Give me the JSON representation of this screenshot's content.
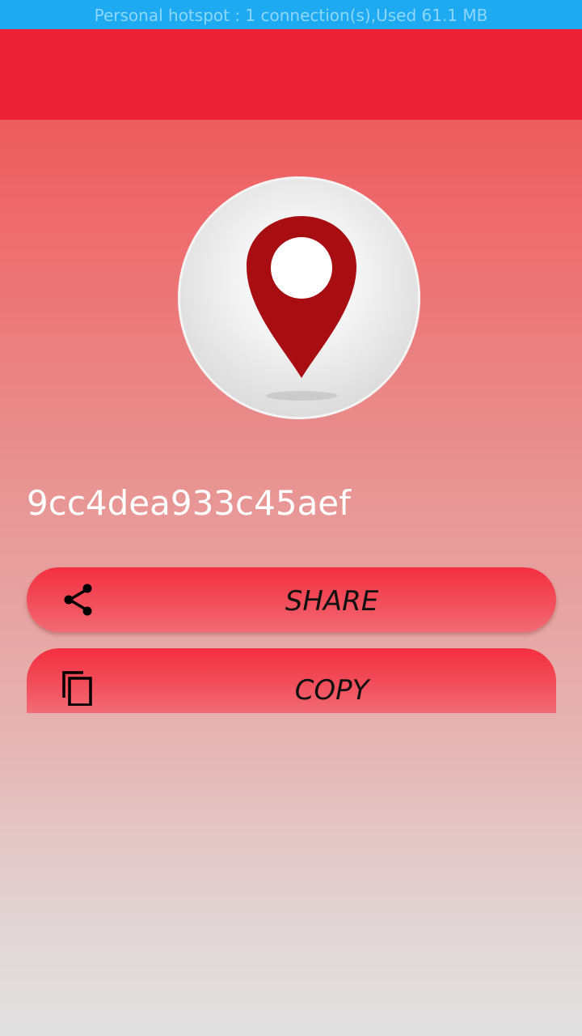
{
  "status_bar": {
    "text": "Personal hotspot : 1 connection(s),Used  61.1 MB"
  },
  "header": {
    "color": "#ed2236"
  },
  "location_graphic": {
    "icon": "map-pin-icon",
    "pin_color": "#a80d12"
  },
  "device_id": "9cc4dea933c45aef",
  "actions": {
    "share": {
      "label": "SHARE",
      "icon": "share-icon"
    },
    "copy": {
      "label": "COPY",
      "icon": "copy-icon"
    }
  },
  "colors": {
    "status_bar": "#1eaaf0",
    "button": "#f42f40"
  }
}
